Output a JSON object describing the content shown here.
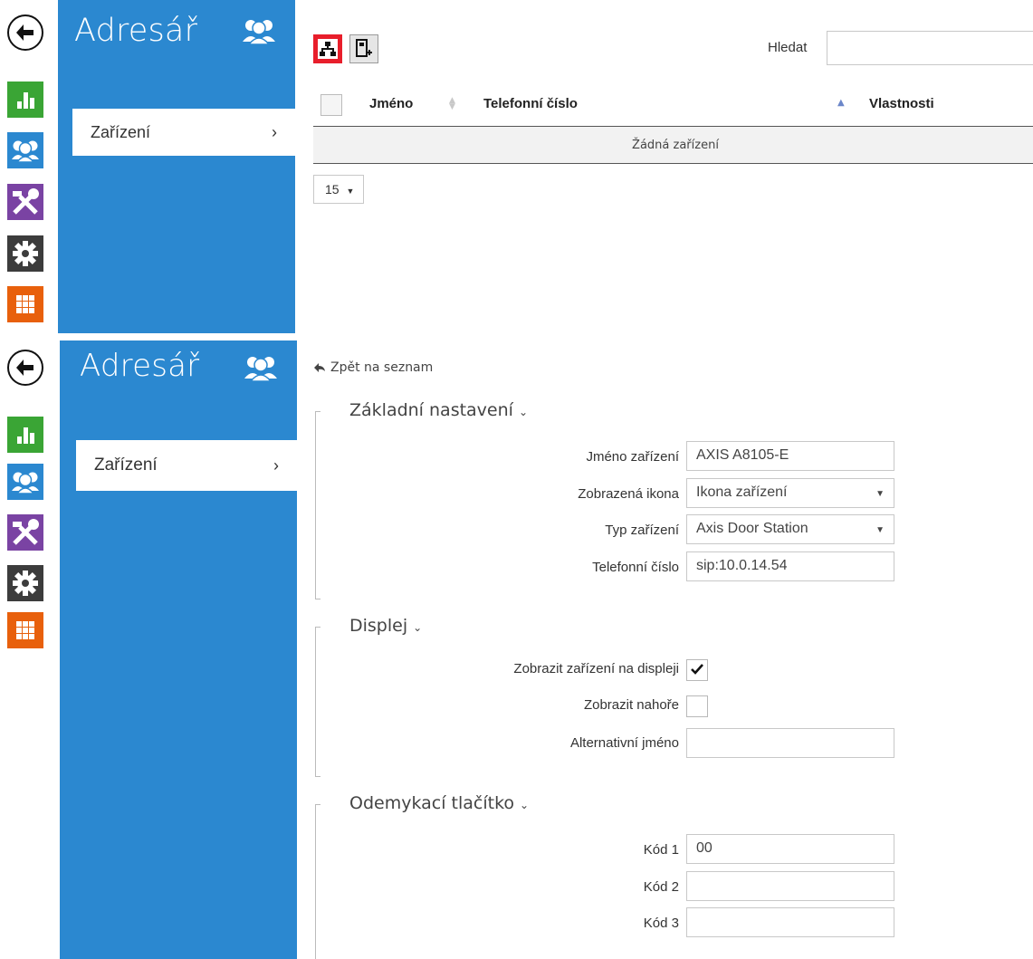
{
  "app": {
    "title": "Adresář"
  },
  "sidebar": {
    "item_label": "Zařízení",
    "item_chevron": "›"
  },
  "list_view": {
    "search_label": "Hledat",
    "search_value": "",
    "columns": {
      "name": "Jméno",
      "phone": "Telefonní číslo",
      "properties": "Vlastnosti"
    },
    "empty_message": "Žádná zařízení",
    "page_size": "15"
  },
  "detail_view": {
    "back_link": "Zpět na seznam",
    "sections": {
      "basic": {
        "title": "Základní nastavení",
        "device_name_label": "Jméno zařízení",
        "device_name_value": "AXIS A8105-E",
        "icon_label": "Zobrazená ikona",
        "icon_value": "Ikona zařízení",
        "type_label": "Typ zařízení",
        "type_value": "Axis Door Station",
        "phone_label": "Telefonní číslo",
        "phone_value": "sip:10.0.14.54"
      },
      "display": {
        "title": "Displej",
        "show_label": "Zobrazit zařízení na displeji",
        "show_checked": true,
        "top_label": "Zobrazit nahoře",
        "top_checked": false,
        "alt_name_label": "Alternativní jméno",
        "alt_name_value": ""
      },
      "unlock": {
        "title": "Odemykací tlačítko",
        "code1_label": "Kód 1",
        "code1_value": "00",
        "code2_label": "Kód 2",
        "code2_value": "",
        "code3_label": "Kód 3",
        "code3_value": ""
      }
    }
  },
  "colors": {
    "sidebar_blue": "#2b88d0",
    "status_green": "#3aa535",
    "directory_blue": "#2b88d0",
    "services_purple": "#7a43a3",
    "settings_dark": "#3c3c3c",
    "system_orange": "#e8600c",
    "highlight_red": "#e81e2b"
  },
  "icons": {
    "back": "arrow-left-icon",
    "status": "bar-chart-icon",
    "directory": "users-icon",
    "services": "tools-icon",
    "settings": "gear-icon",
    "system": "grid-icon",
    "network": "network-icon",
    "add": "add-device-icon"
  }
}
